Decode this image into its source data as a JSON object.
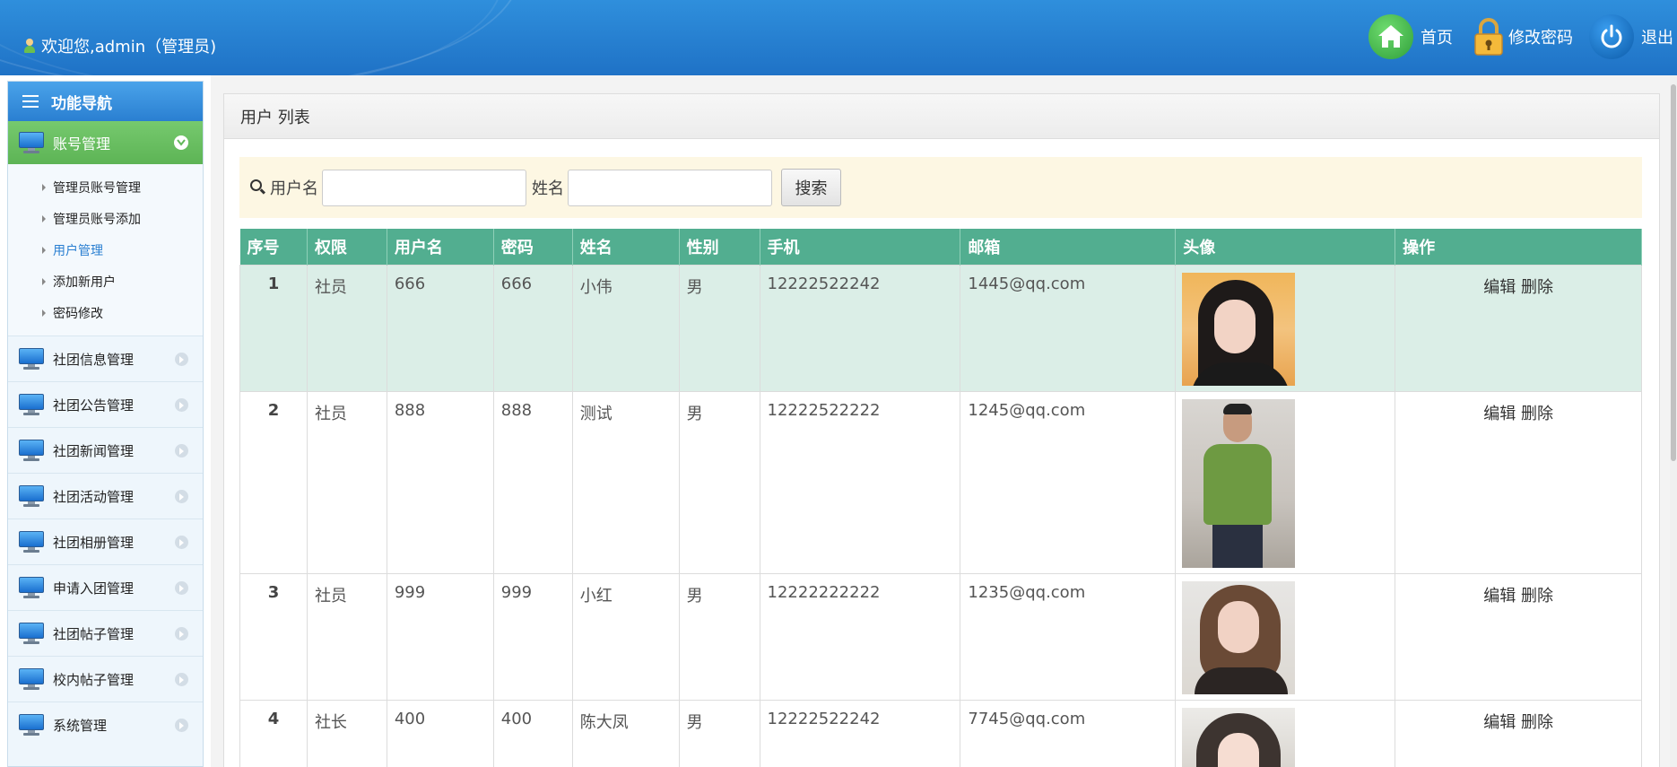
{
  "header": {
    "welcome": "欢迎您,admin（管理员)",
    "links": {
      "home": "首页",
      "change_password": "修改密码",
      "logout": "退出"
    }
  },
  "sidebar": {
    "title": "功能导航",
    "active_group": "账号管理",
    "sub_items": [
      "管理员账号管理",
      "管理员账号添加",
      "用户管理",
      "添加新用户",
      "密码修改"
    ],
    "active_sub_index": 2,
    "groups": [
      "社团信息管理",
      "社团公告管理",
      "社团新闻管理",
      "社团活动管理",
      "社团相册管理",
      "申请入团管理",
      "社团帖子管理",
      "校内帖子管理",
      "系统管理"
    ]
  },
  "panel": {
    "title": "用户 列表"
  },
  "search": {
    "username_label": "用户名",
    "username_value": "",
    "name_label": "姓名",
    "name_value": "",
    "button": "搜索"
  },
  "table": {
    "headers": [
      "序号",
      "权限",
      "用户名",
      "密码",
      "姓名",
      "性别",
      "手机",
      "邮箱",
      "头像",
      "操作"
    ],
    "rows": [
      {
        "seq": "1",
        "role": "社员",
        "username": "666",
        "password": "666",
        "name": "小伟",
        "gender": "男",
        "phone": "12222522242",
        "email": "1445@qq.com",
        "avatar": "avatar-photo-woman-dark-hair"
      },
      {
        "seq": "2",
        "role": "社员",
        "username": "888",
        "password": "888",
        "name": "测试",
        "gender": "男",
        "phone": "12222522222",
        "email": "1245@qq.com",
        "avatar": "avatar-photo-man-green-shirt"
      },
      {
        "seq": "3",
        "role": "社员",
        "username": "999",
        "password": "999",
        "name": "小红",
        "gender": "男",
        "phone": "12222222222",
        "email": "1235@qq.com",
        "avatar": "avatar-photo-woman-brown-hair"
      },
      {
        "seq": "4",
        "role": "社长",
        "username": "400",
        "password": "400",
        "name": "陈大凤",
        "gender": "男",
        "phone": "12222522242",
        "email": "7745@qq.com",
        "avatar": "avatar-photo-woman-bangs"
      }
    ],
    "actions": {
      "edit": "编辑",
      "delete": "删除"
    }
  },
  "colors": {
    "header_blue": "#2178c9",
    "nav_active_green": "#62b85a",
    "table_header_green": "#52ae90",
    "row_highlight": "#dbeee7",
    "search_bg": "#fdf7e3"
  }
}
